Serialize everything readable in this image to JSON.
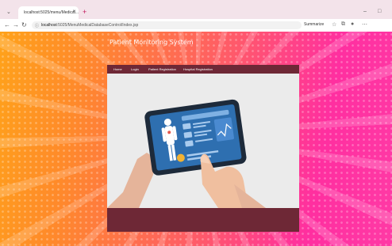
{
  "browser": {
    "tab_title": "localhost:5025/menu/Medical...",
    "url_host": "localhost",
    "url_path": ":5025/MenuMedicalDatabaseControl/Index.jsp",
    "summarize_label": "Summarize"
  },
  "page": {
    "title": "Patient Monitoring System",
    "menu": [
      "Home",
      "Login",
      "Patient Registration",
      "Hospital Registration"
    ]
  },
  "colors": {
    "menu_bg": "#6e2836",
    "hero_bg": "#ebebeb",
    "gradient_left": "#ffa21a",
    "gradient_right": "#ff2fa0"
  },
  "icons": [
    "tab-menu-icon",
    "favicon-icon",
    "close-icon",
    "new-tab-icon",
    "back-icon",
    "forward-icon",
    "reload-icon",
    "info-icon",
    "star-icon",
    "extensions-icon",
    "profile-icon",
    "more-icon",
    "minimize-icon",
    "maximize-icon",
    "close-window-icon"
  ]
}
